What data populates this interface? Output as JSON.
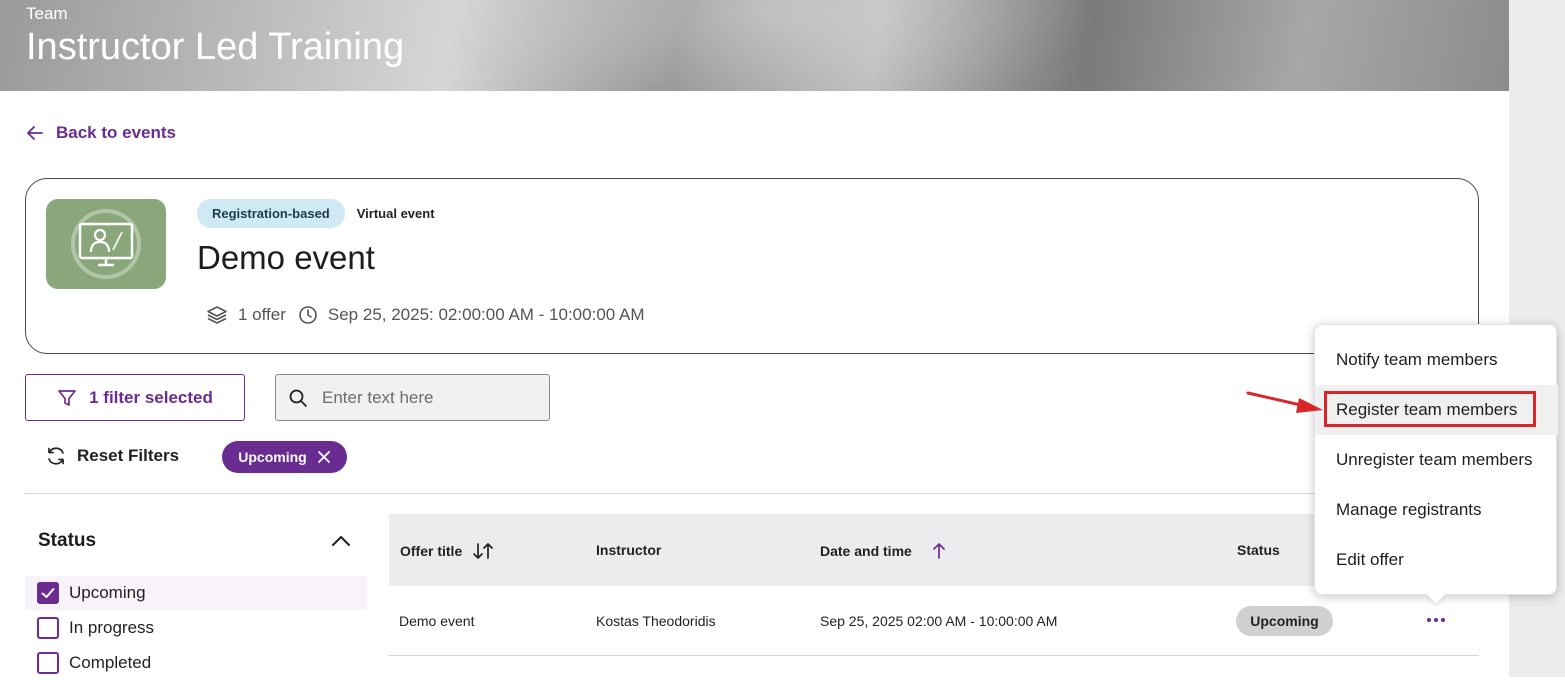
{
  "header": {
    "kicker": "Team",
    "title": "Instructor Led Training"
  },
  "nav": {
    "back_label": "Back to events"
  },
  "event": {
    "tag_registration": "Registration-based",
    "tag_type": "Virtual event",
    "name": "Demo event",
    "offers": "1 offer",
    "datetime": "Sep 25, 2025: 02:00:00 AM - 10:00:00 AM"
  },
  "filters": {
    "button_label": "1 filter selected",
    "search_placeholder": "Enter text here",
    "reset_label": "Reset Filters",
    "active_chip": "Upcoming"
  },
  "status_filter": {
    "title": "Status",
    "options": [
      {
        "label": "Upcoming",
        "checked": true
      },
      {
        "label": "In progress",
        "checked": false
      },
      {
        "label": "Completed",
        "checked": false
      }
    ]
  },
  "table": {
    "columns": [
      "Offer title",
      "Instructor",
      "Date and time",
      "Status"
    ],
    "rows": [
      {
        "offer_title": "Demo event",
        "instructor": "Kostas Theodoridis",
        "date_time": "Sep 25, 2025 02:00 AM - 10:00:00 AM",
        "status": "Upcoming"
      }
    ]
  },
  "actions_menu": {
    "items": [
      "Notify team members",
      "Register team members",
      "Unregister team members",
      "Manage registrants",
      "Edit offer"
    ]
  },
  "colors": {
    "accent": "#6b2c91",
    "annotation": "#d8262b",
    "tag_bg": "#cfeaf2",
    "thumb_bg": "#8aa77c"
  }
}
